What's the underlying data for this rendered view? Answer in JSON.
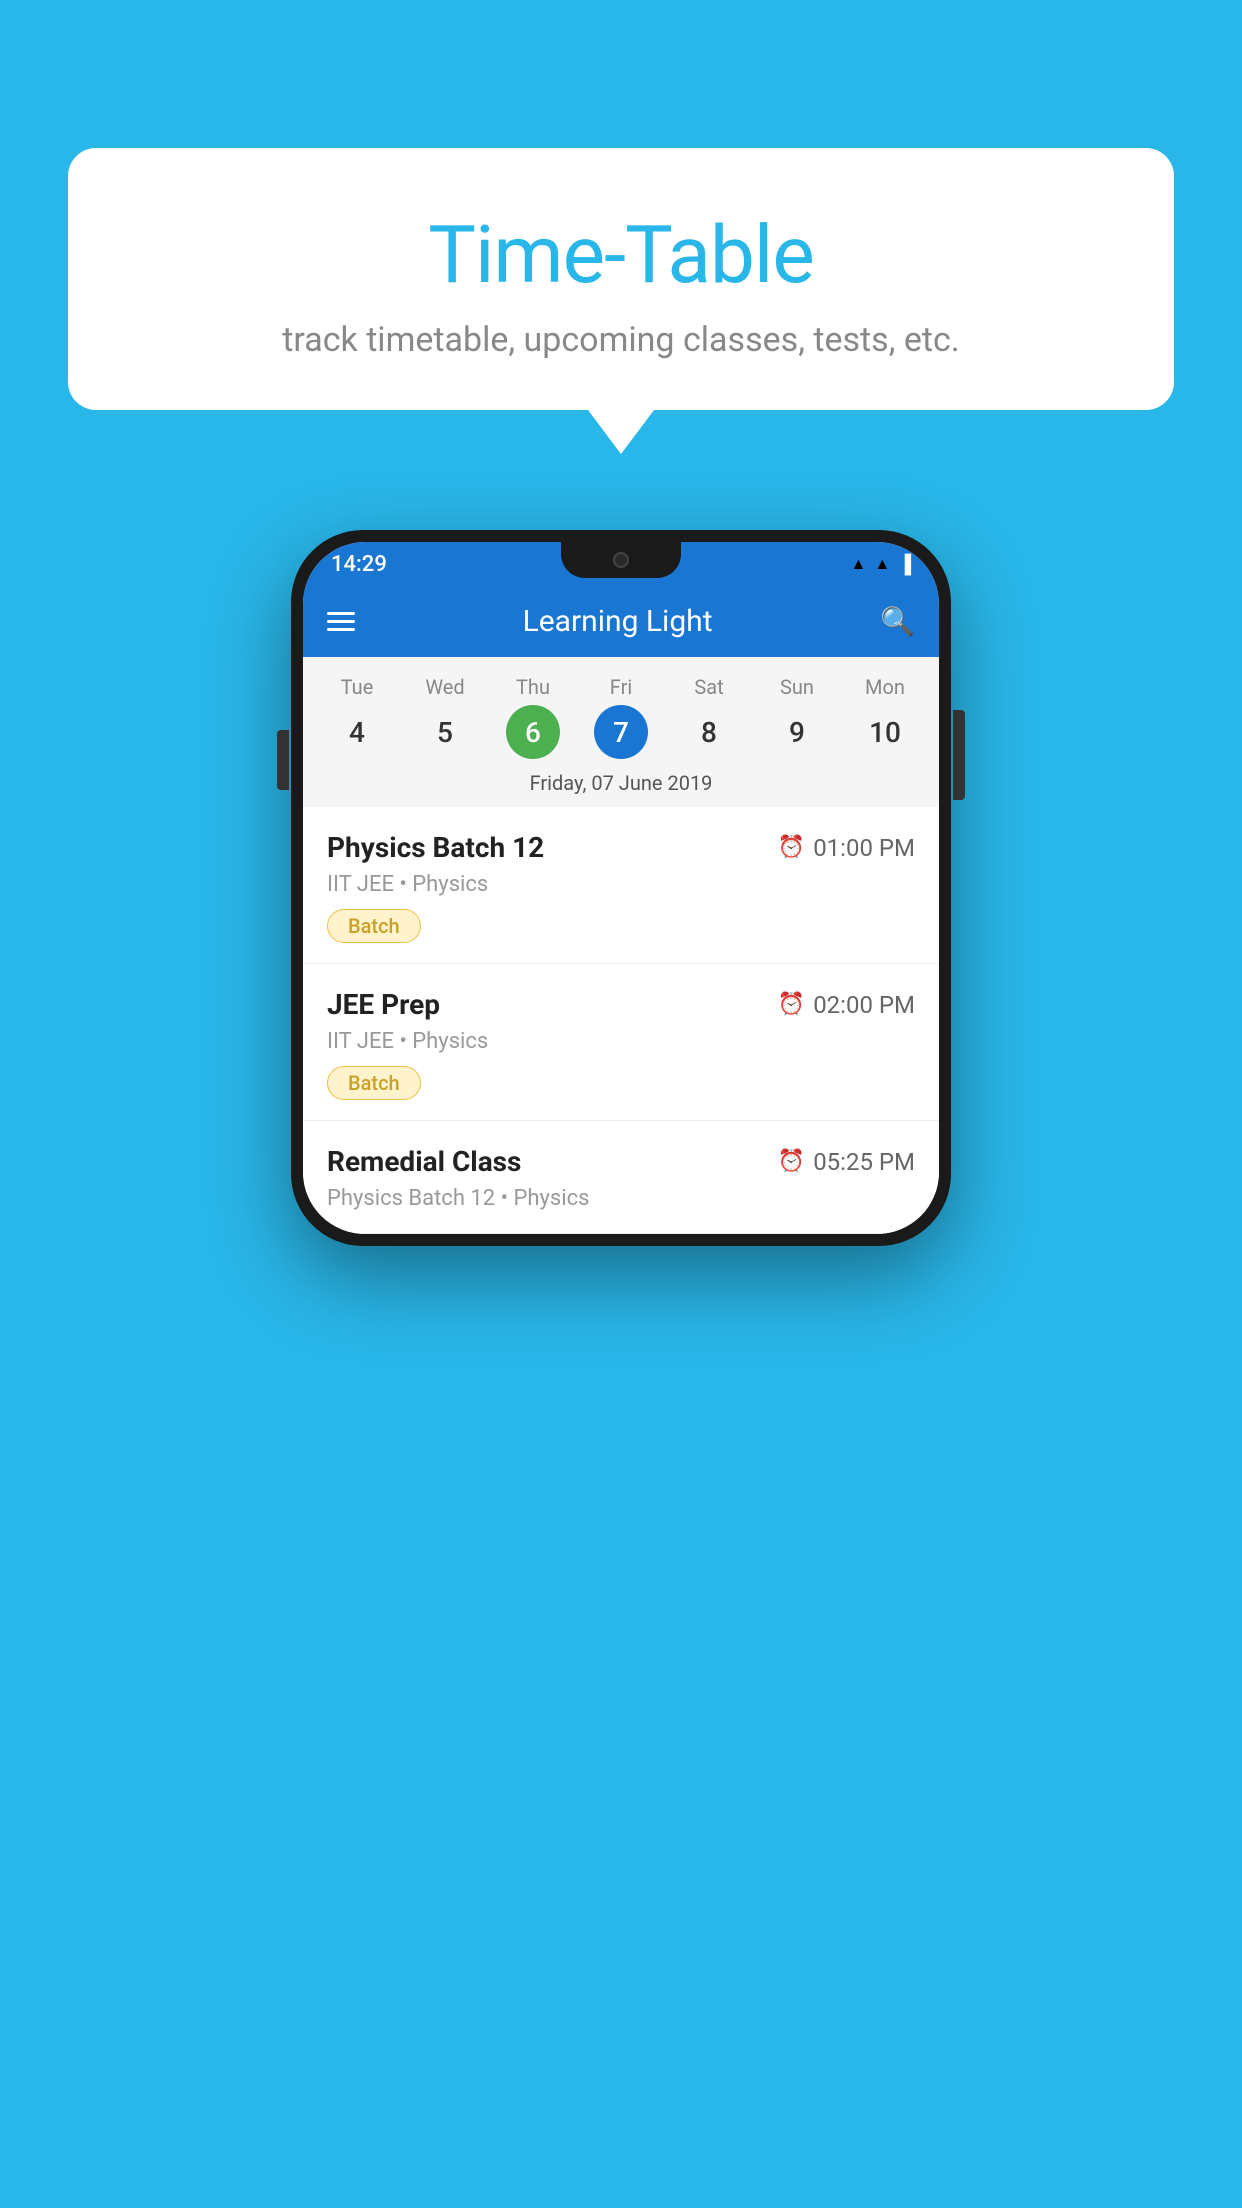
{
  "background_color": "#29B6E8",
  "tooltip": {
    "title": "Time-Table",
    "subtitle": "track timetable, upcoming classes, tests, etc."
  },
  "phone": {
    "status_bar": {
      "time": "14:29",
      "icons": [
        "wifi",
        "signal",
        "battery"
      ]
    },
    "app_bar": {
      "title": "Learning Light",
      "menu_icon": "hamburger",
      "search_icon": "search"
    },
    "calendar": {
      "days": [
        {
          "name": "Tue",
          "num": "4",
          "state": "normal"
        },
        {
          "name": "Wed",
          "num": "5",
          "state": "normal"
        },
        {
          "name": "Thu",
          "num": "6",
          "state": "today"
        },
        {
          "name": "Fri",
          "num": "7",
          "state": "selected"
        },
        {
          "name": "Sat",
          "num": "8",
          "state": "normal"
        },
        {
          "name": "Sun",
          "num": "9",
          "state": "normal"
        },
        {
          "name": "Mon",
          "num": "10",
          "state": "normal"
        }
      ],
      "selected_date_label": "Friday, 07 June 2019"
    },
    "schedule": [
      {
        "title": "Physics Batch 12",
        "time": "01:00 PM",
        "subtitle": "IIT JEE • Physics",
        "badge": "Batch"
      },
      {
        "title": "JEE Prep",
        "time": "02:00 PM",
        "subtitle": "IIT JEE • Physics",
        "badge": "Batch"
      },
      {
        "title": "Remedial Class",
        "time": "05:25 PM",
        "subtitle": "Physics Batch 12 • Physics",
        "badge": null,
        "partial": true
      }
    ]
  }
}
